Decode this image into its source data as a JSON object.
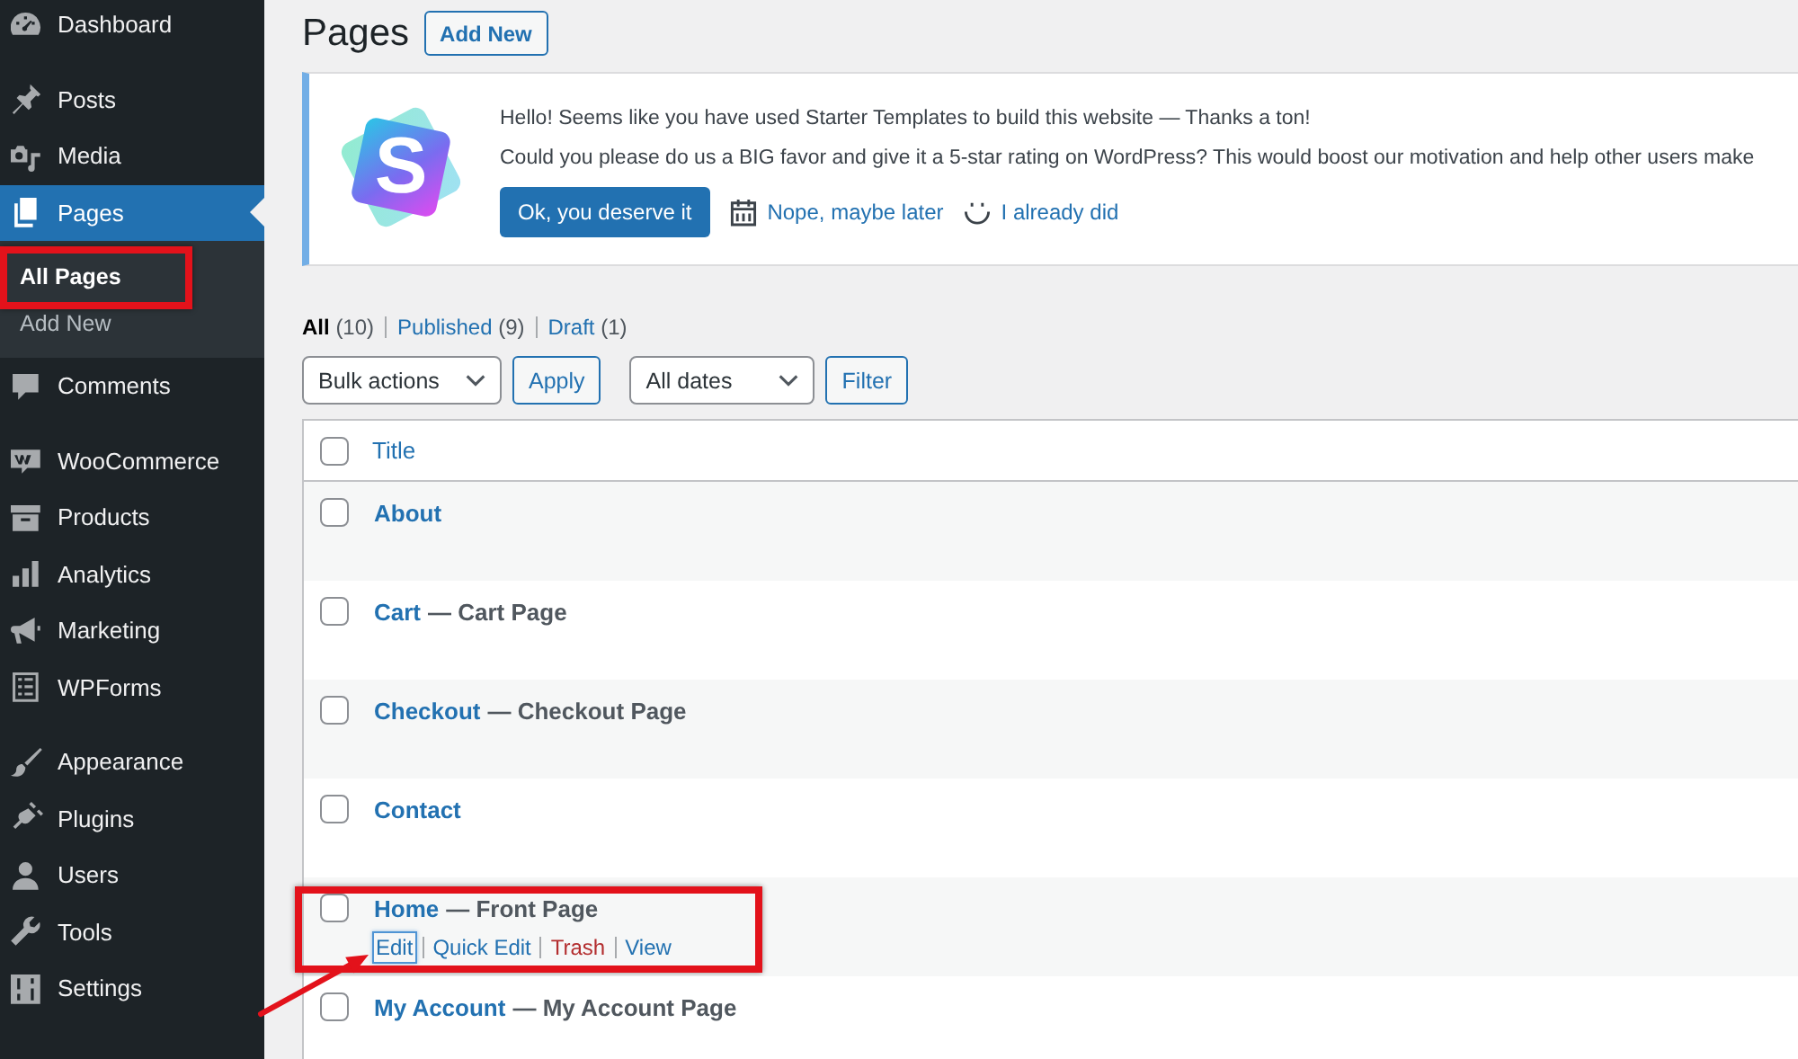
{
  "sidebar": {
    "groups": [
      {
        "items": [
          {
            "label": "Dashboard",
            "selected": false
          }
        ]
      },
      {
        "items": [
          {
            "label": "Posts",
            "selected": false
          },
          {
            "label": "Media",
            "selected": false
          },
          {
            "label": "Pages",
            "selected": true,
            "children": [
              {
                "label": "All Pages",
                "selected": true,
                "highlighted": true
              },
              {
                "label": "Add New",
                "selected": false,
                "highlighted": false
              }
            ]
          },
          {
            "label": "Comments",
            "selected": false
          }
        ]
      },
      {
        "items": [
          {
            "label": "WooCommerce",
            "selected": false
          },
          {
            "label": "Products",
            "selected": false
          },
          {
            "label": "Analytics",
            "selected": false
          },
          {
            "label": "Marketing",
            "selected": false
          },
          {
            "label": "WPForms",
            "selected": false
          }
        ]
      },
      {
        "items": [
          {
            "label": "Appearance",
            "selected": false
          },
          {
            "label": "Plugins",
            "selected": false
          },
          {
            "label": "Users",
            "selected": false
          },
          {
            "label": "Tools",
            "selected": false
          },
          {
            "label": "Settings",
            "selected": false
          }
        ]
      }
    ]
  },
  "header": {
    "title": "Pages",
    "add_button": "Add New"
  },
  "notice": {
    "logo_text": "S",
    "lines": [
      "Hello! Seems like you have used Starter Templates to build this website — Thanks a ton!",
      "Could you please do us a BIG favor and give it a 5-star rating on WordPress? This would boost our motivation and help other users make"
    ],
    "primary_button": "Ok, you deserve it",
    "links": [
      {
        "label": "Nope, maybe later"
      },
      {
        "label": "I already did"
      }
    ]
  },
  "views": [
    {
      "label": "All",
      "count": "(10)",
      "selected": true
    },
    {
      "label": "Published",
      "count": "(9)",
      "selected": false
    },
    {
      "label": "Draft",
      "count": "(1)",
      "selected": false
    }
  ],
  "tablenav": {
    "bulk_actions": "Bulk actions",
    "apply": "Apply",
    "dates": "All dates",
    "filter": "Filter"
  },
  "table": {
    "header_checked": false,
    "columns": [
      {
        "label": "Title"
      }
    ],
    "rows": [
      {
        "title": "About",
        "checked": false,
        "highlighted": false
      },
      {
        "title": "Cart",
        "state": "— Cart Page",
        "checked": false,
        "highlighted": false
      },
      {
        "title": "Checkout",
        "state": "— Checkout Page",
        "checked": false,
        "highlighted": false
      },
      {
        "title": "Contact",
        "checked": false,
        "highlighted": false
      },
      {
        "title": "Home",
        "state": "— Front Page",
        "checked": false,
        "highlighted": true,
        "actions": [
          {
            "label": "Edit",
            "kind": "link",
            "focused": true
          },
          {
            "label": "Quick Edit",
            "kind": "link",
            "focused": false
          },
          {
            "label": "Trash",
            "kind": "danger",
            "focused": false
          },
          {
            "label": "View",
            "kind": "link",
            "focused": false
          }
        ]
      },
      {
        "title": "My Account",
        "state": "— My Account Page",
        "checked": false,
        "highlighted": false
      }
    ]
  }
}
